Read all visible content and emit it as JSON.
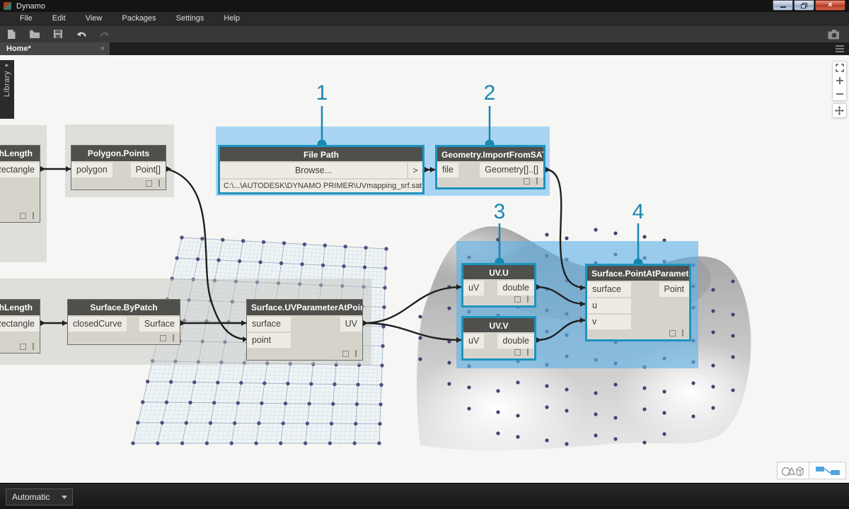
{
  "window": {
    "title": "Dynamo",
    "controls": [
      "minimize",
      "restore",
      "close"
    ],
    "close_glyph": "×"
  },
  "menus": [
    "File",
    "Edit",
    "View",
    "Packages",
    "Settings",
    "Help"
  ],
  "toolbar_icons": [
    "new-file-icon",
    "open-icon",
    "save-icon",
    "undo-icon",
    "redo-icon",
    "camera-icon"
  ],
  "tab": {
    "label": "Home*",
    "close": "×"
  },
  "library": {
    "label": "Library"
  },
  "callouts": [
    "1",
    "2",
    "3",
    "4"
  ],
  "colors": {
    "selection": "#1d94bf",
    "callout": "#1787ad",
    "highlight_top": "#a9d5f2",
    "highlight_bottom": "#7cbfec",
    "wire": "#1f1f1f",
    "node_header": "#4f4f4c",
    "node_body": "#d6d3ca",
    "port": "#edebe4",
    "point_dot": "#4a4070"
  },
  "nodes": {
    "rect_top": {
      "title": "Rectangle.ByWidthLength",
      "out": "Rectangle"
    },
    "polygon_points": {
      "title": "Polygon.Points",
      "in": "polygon",
      "out": "Point[]"
    },
    "file_path": {
      "title": "File Path",
      "browse": "Browse...",
      "chevron": ">",
      "path": "C:\\...\\AUTODESK\\DYNAMO PRIMER\\UVmapping_srf.sat"
    },
    "import_sat": {
      "title": "Geometry.ImportFromSAT",
      "in": "file",
      "out": "Geometry[]..[]"
    },
    "uv_u": {
      "title": "UV.U",
      "in": "uV",
      "out": "double"
    },
    "uv_v": {
      "title": "UV.V",
      "in": "uV",
      "out": "double"
    },
    "point_at_parameter": {
      "title": "Surface.PointAtParameter",
      "in0": "surface",
      "in1": "u",
      "in2": "v",
      "out": "Point"
    },
    "rect_bottom": {
      "title": "Rectangle.ByWidthLength",
      "out": "Rectangle"
    },
    "by_patch": {
      "title": "Surface.ByPatch",
      "in": "closedCurve",
      "out": "Surface"
    },
    "uv_param_at_point": {
      "title": "Surface.UVParameterAtPoint",
      "in0": "surface",
      "in1": "point",
      "out": "UV"
    }
  },
  "nav_icons": [
    "fit-view-icon",
    "zoom-in-icon",
    "zoom-out-icon",
    "pan-icon"
  ],
  "view_toggles": [
    "geometry-view",
    "graph-view"
  ],
  "statusbar": {
    "run_mode": "Automatic"
  }
}
